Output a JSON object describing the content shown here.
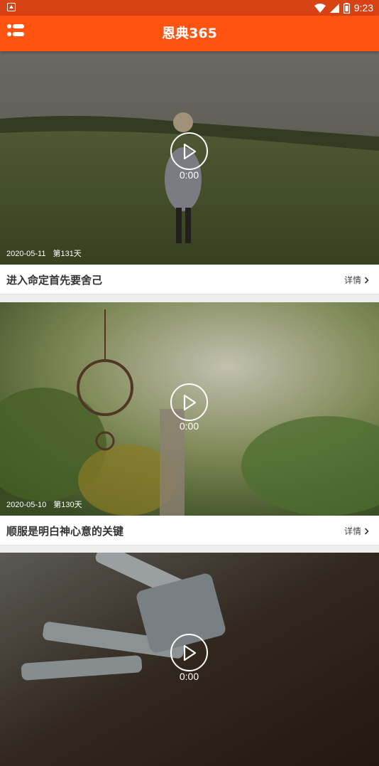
{
  "status_bar": {
    "time": "9:23",
    "icons": [
      "android-notification-icon",
      "wifi-icon",
      "signal-icon",
      "battery-icon"
    ]
  },
  "app_bar": {
    "title": "恩典365",
    "menu_icon": "list-menu-icon",
    "color": "#ff5411"
  },
  "cards": [
    {
      "date": "2020-05-11",
      "day": "第131天",
      "duration": "0:00",
      "title": "进入命定首先要舍己",
      "detail_label": "详情"
    },
    {
      "date": "2020-05-10",
      "day": "第130天",
      "duration": "0:00",
      "title": "顺服是明白神心意的关键",
      "detail_label": "详情"
    },
    {
      "duration": "0:00"
    }
  ]
}
